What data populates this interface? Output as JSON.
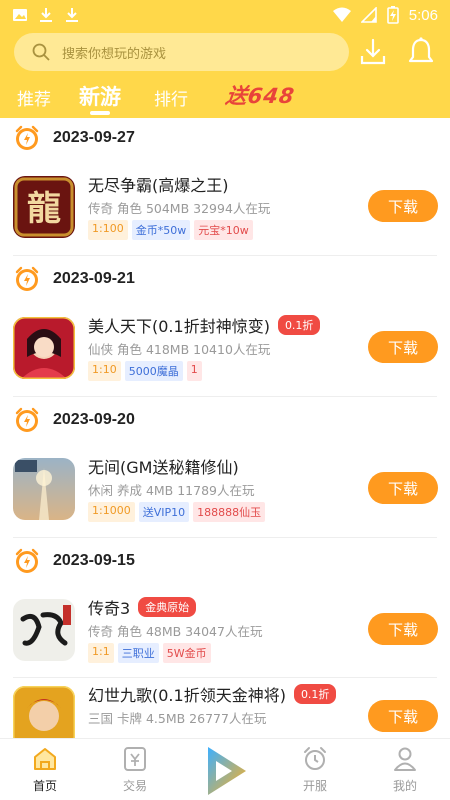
{
  "status": {
    "time": "5:06"
  },
  "search": {
    "placeholder": "搜索你想玩的游戏"
  },
  "tabs": [
    {
      "label": "推荐"
    },
    {
      "label": "新游"
    },
    {
      "label": "排行"
    }
  ],
  "promo": {
    "text": "送648"
  },
  "sections": [
    {
      "date": "2023-09-27",
      "games": [
        {
          "name": "无尽争霸(高爆之王)",
          "badge": "",
          "meta": "传奇 角色 504MB 32994人在玩",
          "tags": [
            {
              "text": "1:100",
              "style": "orange"
            },
            {
              "text": "金币*50w",
              "style": "blue"
            },
            {
              "text": "元宝*10w",
              "style": "red"
            }
          ]
        }
      ]
    },
    {
      "date": "2023-09-21",
      "games": [
        {
          "name": "美人天下(0.1折封神惊变)",
          "badge": "0.1折",
          "meta": "仙侠 角色 418MB 10410人在玩",
          "tags": [
            {
              "text": "1:10",
              "style": "orange"
            },
            {
              "text": "5000魔晶",
              "style": "blue"
            },
            {
              "text": "1",
              "style": "red"
            }
          ]
        }
      ]
    },
    {
      "date": "2023-09-20",
      "games": [
        {
          "name": "无间(GM送秘籍修仙)",
          "badge": "",
          "meta": "休闲 养成 4MB 11789人在玩",
          "tags": [
            {
              "text": "1:1000",
              "style": "orange"
            },
            {
              "text": "送VIP10",
              "style": "blue"
            },
            {
              "text": "188888仙玉",
              "style": "red"
            }
          ]
        }
      ]
    },
    {
      "date": "2023-09-15",
      "games": [
        {
          "name": "传奇3",
          "badge": "金典原始",
          "meta": "传奇 角色 48MB 34047人在玩",
          "tags": [
            {
              "text": "1:1",
              "style": "orange"
            },
            {
              "text": "三职业",
              "style": "blue"
            },
            {
              "text": "5W金币",
              "style": "red"
            }
          ]
        },
        {
          "name": "幻世九歌(0.1折领天金神将)",
          "badge": "0.1折",
          "meta": "三国 卡牌 4.5MB 26777人在玩",
          "tags": []
        }
      ]
    }
  ],
  "download_label": "下载",
  "bottom_nav": [
    {
      "label": "首页"
    },
    {
      "label": "交易"
    },
    {
      "label": "开服"
    },
    {
      "label": "我的"
    }
  ],
  "colors": {
    "header": "#FFD84A",
    "download": "#FF9A1F",
    "badge": "#F04B43",
    "clock": "#FF9A1F"
  },
  "icons": [
    "image-icon",
    "download-icon",
    "wifi-icon",
    "signal-icon",
    "battery-icon",
    "search-icon",
    "download-manager-icon",
    "bell-icon",
    "clock-icon",
    "home-icon",
    "trade-icon",
    "play-icon",
    "alarm-icon",
    "user-icon"
  ]
}
